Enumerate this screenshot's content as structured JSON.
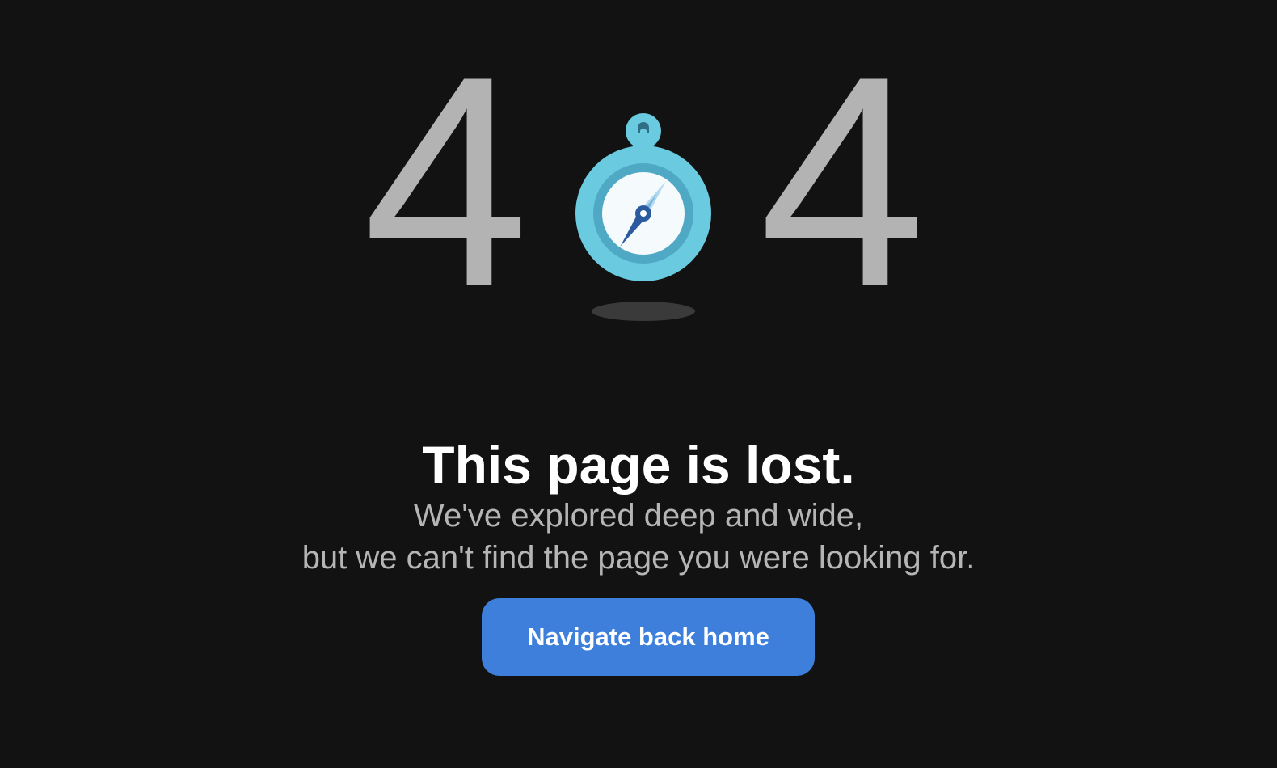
{
  "error_code": {
    "first_digit": "4",
    "last_digit": "4",
    "middle_icon": "compass-icon"
  },
  "headline": "This page is lost.",
  "subtext": {
    "line1": "We've explored deep and wide,",
    "line2": "but we can't find the page you were looking for."
  },
  "home_button": {
    "label": "Navigate back home"
  },
  "colors": {
    "background": "#121212",
    "digit": "#b3b3b3",
    "compass_outer": "#6acbe0",
    "compass_ring": "#4fa9c4",
    "compass_face": "#f5fbfd",
    "needle": "#2c5a9e",
    "button": "#3f7fdc",
    "headline": "#ffffff",
    "subtext": "#b5b5b5"
  }
}
